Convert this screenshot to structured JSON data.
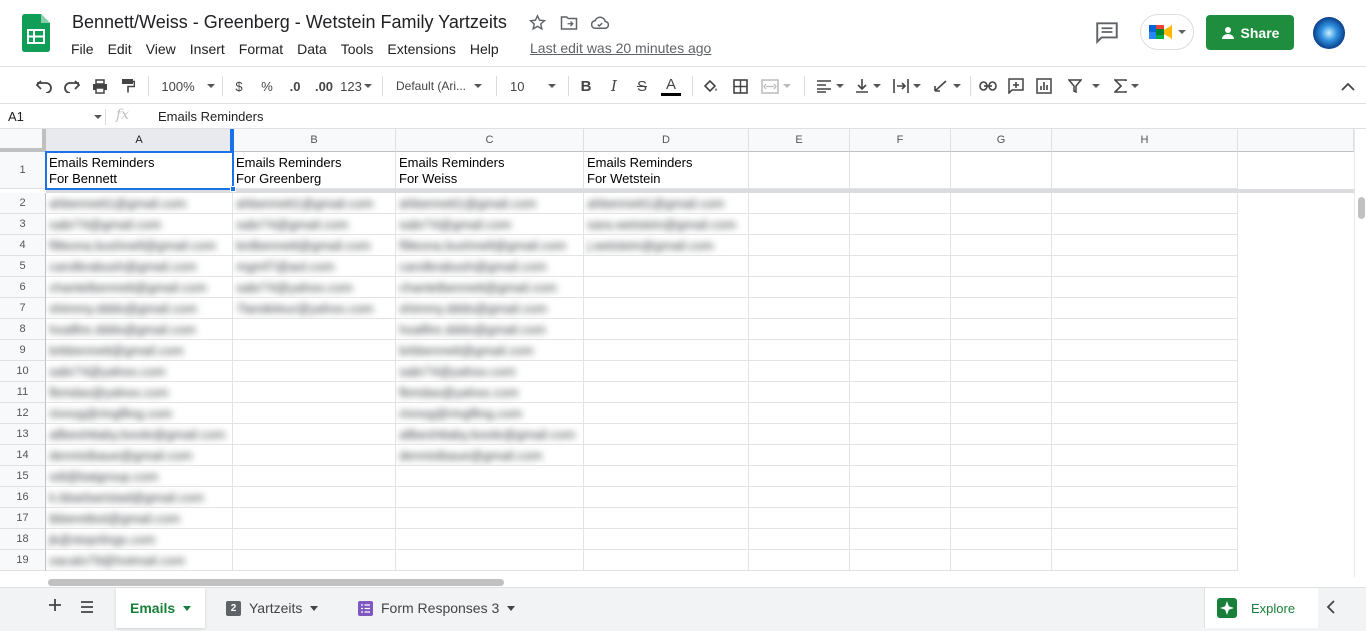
{
  "app": {
    "doc_title": "Bennett/Weiss - Greenberg - Wetstein Family Yartzeits",
    "last_edit": "Last edit was 20 minutes ago",
    "share_label": "Share",
    "accent": "#1e8e3e"
  },
  "menu": [
    "File",
    "Edit",
    "View",
    "Insert",
    "Format",
    "Data",
    "Tools",
    "Extensions",
    "Help"
  ],
  "toolbar": {
    "zoom": "100%",
    "currency": "$",
    "percent": "%",
    "dec_decrease": ".0",
    "dec_increase": ".00",
    "more_formats": "123",
    "font": "Default (Ari...",
    "font_size": "10",
    "bold": "B",
    "italic": "I",
    "strike": "S",
    "text_color": "A"
  },
  "formula_bar": {
    "cell_ref": "A1",
    "fx": "fx",
    "content": "Emails Reminders"
  },
  "columns": [
    "A",
    "B",
    "C",
    "D",
    "E",
    "F",
    "G",
    "H"
  ],
  "rows": [
    "1",
    "2",
    "3",
    "4",
    "5",
    "6",
    "7",
    "8",
    "9",
    "10",
    "11",
    "12",
    "13",
    "14",
    "15",
    "16",
    "17",
    "18",
    "19"
  ],
  "headers": [
    {
      "line1": "Emails Reminders",
      "line2": "For Bennett"
    },
    {
      "line1": "Emails Reminders",
      "line2": "For Greenberg"
    },
    {
      "line1": "Emails Reminders",
      "line2": "For Weiss"
    },
    {
      "line1": "Emails Reminders",
      "line2": "For Wetstein"
    }
  ],
  "cells": {
    "A": [
      "ahbennett1@gmail.com",
      "sabr74@gmail.com",
      "f9leona.bushnell@gmail.com",
      "carolbrabush@gmail.com",
      "chantelbennett@gmail.com",
      "shimmy.ddds@gmail.com",
      "hoalfire.ddds@gmail.com",
      "brbbennett@gmail.com",
      "sabr74@yahoo.com",
      "fbmdas@yahoo.com",
      "rinnog@ringfling.com",
      "allbeshttaby.boole@gmail.com",
      "dennistbaue@gmail.com",
      "sdi@batgroup.com",
      "k.bbarbaristad@gmail.com",
      "tbberetbot@gmail.com",
      "jk@stoprlings.com",
      "oacalo79@hotmail.com"
    ],
    "B": [
      "ahbennett1@gmail.com",
      "sabr74@gmail.com",
      "brdbennett@gmail.com",
      "mgmf7@aol.com",
      "sabr74@yahoo.com",
      "7landeleur@yahoo.com"
    ],
    "C": [
      "ahbennett1@gmail.com",
      "sabr74@gmail.com",
      "f9leona.bushnell@gmail.com",
      "carolbrabush@gmail.com",
      "chantelbennett@gmail.com",
      "shimmy.ddds@gmail.com",
      "hoalfire.ddds@gmail.com",
      "brbbennett@gmail.com",
      "sabr74@yahoo.com",
      "fbmdas@yahoo.com",
      "rinnog@ringfling.com",
      "allbeshttaby.boole@gmail.com",
      "dennistbaue@gmail.com"
    ],
    "D": [
      "ahbennett1@gmail.com",
      "sara.wetstein@gmail.com",
      "j.wetstein@gmail.com"
    ]
  },
  "tabs": [
    {
      "label": "Emails",
      "active": true,
      "icon": ""
    },
    {
      "label": "Yartzeits",
      "active": false,
      "icon": "2"
    },
    {
      "label": "Form Responses 3",
      "active": false,
      "icon": "form-icon"
    }
  ],
  "explore_label": "Explore"
}
